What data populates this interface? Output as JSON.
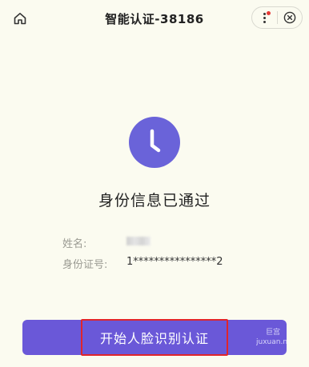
{
  "header": {
    "title": "智能认证-38186"
  },
  "status": {
    "message": "身份信息已通过"
  },
  "info": {
    "name_label": "姓名:",
    "id_label": "身份证号:",
    "id_value": "1****************2"
  },
  "action": {
    "start_label": "开始人脸识别认证"
  },
  "watermark": {
    "line1": "巨宫",
    "line2": "juxuan.n"
  },
  "colors": {
    "accent": "#6a58d8",
    "clock": "#6a63d9",
    "highlight_border": "#e0242b",
    "notification_dot": "#e53935"
  }
}
